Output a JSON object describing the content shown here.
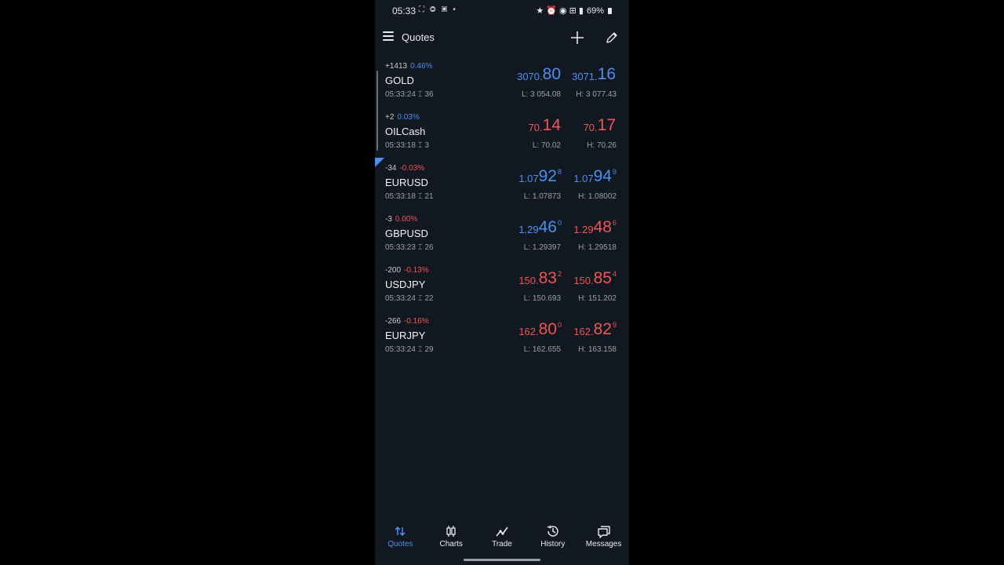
{
  "status_bar": {
    "time": "05:33",
    "left_icons": "⛶ ◎ ▣ •",
    "right_icons": "★ ⏰ ◉ ⊞ ▮",
    "battery": "69%"
  },
  "header": {
    "title": "Quotes"
  },
  "quotes": [
    {
      "change_points": "+1413",
      "change_pct": "0.46%",
      "change_dir": "pos",
      "symbol": "GOLD",
      "time": "05:33:24",
      "spread": "36",
      "bid": {
        "small": "3070.",
        "big": "80",
        "sup": "",
        "dir": "pos"
      },
      "ask": {
        "small": "3071.",
        "big": "16",
        "sup": "",
        "dir": "pos"
      },
      "low": "L: 3 054.08",
      "high": "H: 3 077.43"
    },
    {
      "change_points": "+2",
      "change_pct": "0.03%",
      "change_dir": "pos",
      "symbol": "OILCash",
      "time": "05:33:18",
      "spread": "3",
      "bid": {
        "small": "70.",
        "big": "14",
        "sup": "",
        "dir": "neg"
      },
      "ask": {
        "small": "70.",
        "big": "17",
        "sup": "",
        "dir": "neg"
      },
      "low": "L: 70.02",
      "high": "H: 70.26"
    },
    {
      "change_points": "-34",
      "change_pct": "-0.03%",
      "change_dir": "neg",
      "symbol": "EURUSD",
      "time": "05:33:18",
      "spread": "21",
      "bid": {
        "small": "1.07",
        "big": "92",
        "sup": "8",
        "dir": "pos"
      },
      "ask": {
        "small": "1.07",
        "big": "94",
        "sup": "9",
        "dir": "pos"
      },
      "low": "L: 1.07873",
      "high": "H: 1.08002"
    },
    {
      "change_points": "-3",
      "change_pct": "0.00%",
      "change_dir": "neg",
      "symbol": "GBPUSD",
      "time": "05:33:23",
      "spread": "26",
      "bid": {
        "small": "1.29",
        "big": "46",
        "sup": "0",
        "dir": "pos"
      },
      "ask": {
        "small": "1.29",
        "big": "48",
        "sup": "6",
        "dir": "neg"
      },
      "low": "L: 1.29397",
      "high": "H: 1.29518"
    },
    {
      "change_points": "-200",
      "change_pct": "-0.13%",
      "change_dir": "neg",
      "symbol": "USDJPY",
      "time": "05:33:24",
      "spread": "22",
      "bid": {
        "small": "150.",
        "big": "83",
        "sup": "2",
        "dir": "neg"
      },
      "ask": {
        "small": "150.",
        "big": "85",
        "sup": "4",
        "dir": "neg"
      },
      "low": "L: 150.693",
      "high": "H: 151.202"
    },
    {
      "change_points": "-266",
      "change_pct": "-0.16%",
      "change_dir": "neg",
      "symbol": "EURJPY",
      "time": "05:33:24",
      "spread": "29",
      "bid": {
        "small": "162.",
        "big": "80",
        "sup": "0",
        "dir": "neg"
      },
      "ask": {
        "small": "162.",
        "big": "82",
        "sup": "9",
        "dir": "neg"
      },
      "low": "L: 162.655",
      "high": "H: 163.158"
    }
  ],
  "spread_icon": "⌶",
  "bottom_nav": [
    {
      "label": "Quotes",
      "icon": "quotes-arrows-icon",
      "active": true
    },
    {
      "label": "Charts",
      "icon": "candlestick-icon",
      "active": false
    },
    {
      "label": "Trade",
      "icon": "trend-line-icon",
      "active": false
    },
    {
      "label": "History",
      "icon": "history-clock-icon",
      "active": false
    },
    {
      "label": "Messages",
      "icon": "messages-icon",
      "active": false
    }
  ],
  "colors": {
    "accent_blue": "#4a90f2",
    "negative_red": "#f05454",
    "background": "#121821"
  }
}
